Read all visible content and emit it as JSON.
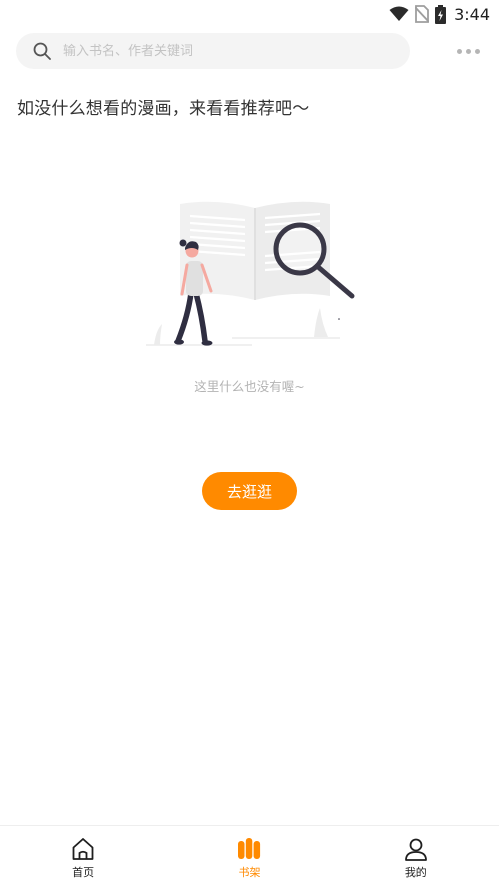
{
  "status_bar": {
    "time": "3:44"
  },
  "search": {
    "placeholder": "输入书名、作者关键词"
  },
  "headline": "如没什么想看的漫画，来看看推荐吧～",
  "empty_state": {
    "message": "这里什么也没有喔~",
    "button_label": "去逛逛"
  },
  "bottom_nav": {
    "items": [
      {
        "label": "首页",
        "icon": "home-icon",
        "active": false
      },
      {
        "label": "书架",
        "icon": "bookshelf-icon",
        "active": true
      },
      {
        "label": "我的",
        "icon": "profile-icon",
        "active": false
      }
    ]
  },
  "colors": {
    "accent": "#ff8a00",
    "text_primary": "#333333",
    "text_muted": "#b3b3b3",
    "search_bg": "#f4f4f4"
  }
}
